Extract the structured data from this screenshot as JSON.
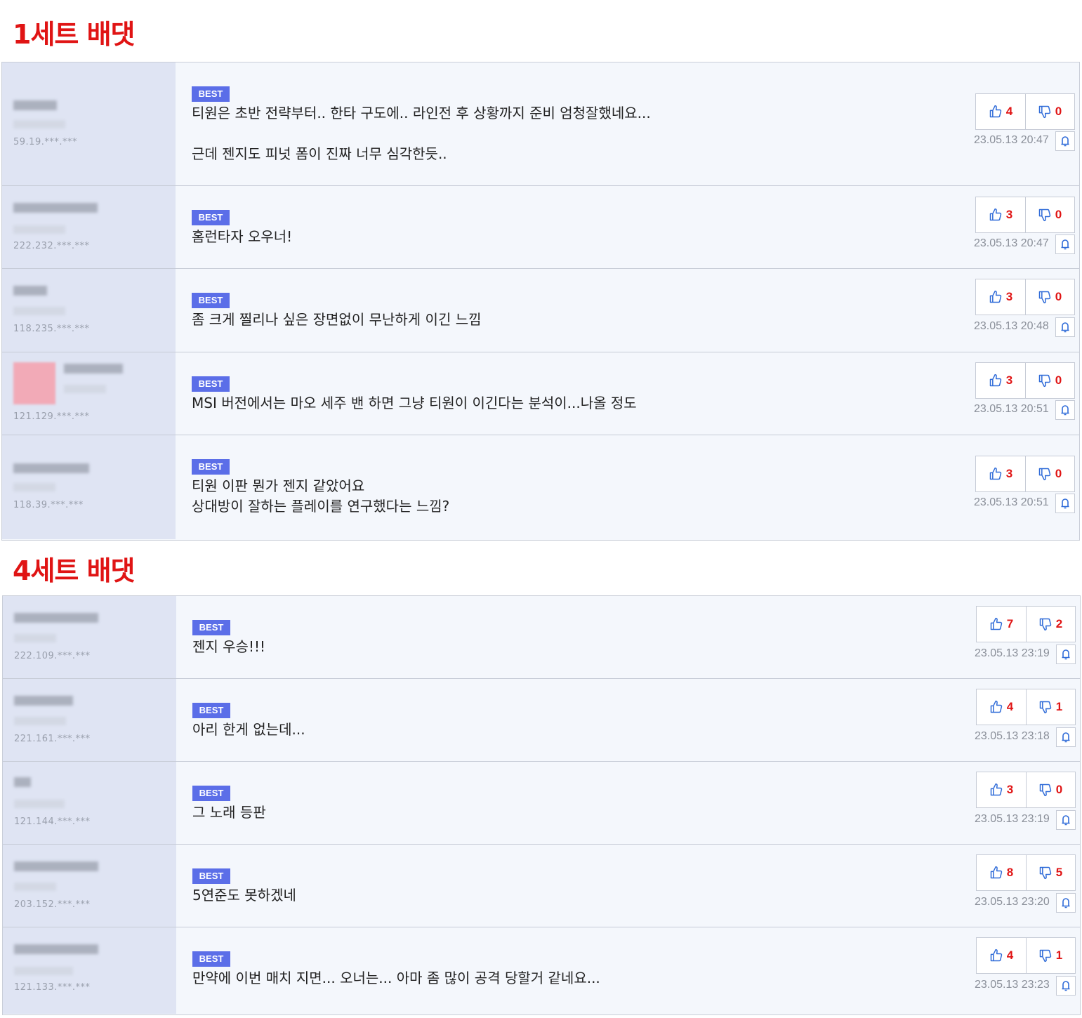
{
  "sections": [
    {
      "title": "1세트 배댓",
      "comments": [
        {
          "ip": "59.19.***.***",
          "badge": "BEST",
          "text": "티원은 초반 전략부터.. 한타 구도에.. 라인전 후 상황까지 준비 엄청잘했네요...\n\n근데 젠지도 피넛 폼이 진짜 너무 심각한듯..",
          "likes": "4",
          "dislikes": "0",
          "date": "23.05.13 20:47"
        },
        {
          "ip": "222.232.***.***",
          "badge": "BEST",
          "text": "홈런타자 오우너!",
          "likes": "3",
          "dislikes": "0",
          "date": "23.05.13 20:47"
        },
        {
          "ip": "118.235.***.***",
          "badge": "BEST",
          "text": "좀 크게 찔리나 싶은 장면없이 무난하게 이긴 느낌",
          "likes": "3",
          "dislikes": "0",
          "date": "23.05.13 20:48"
        },
        {
          "ip": "121.129.***.***",
          "badge": "BEST",
          "text": "MSI 버전에서는 마오 세주 밴 하면 그냥 티원이 이긴다는 분석이...나올 정도",
          "likes": "3",
          "dislikes": "0",
          "date": "23.05.13 20:51"
        },
        {
          "ip": "118.39.***.***",
          "badge": "BEST",
          "text": "티원 이판 뭔가 젠지 같았어요\n상대방이 잘하는 플레이를 연구했다는 느낌?",
          "likes": "3",
          "dislikes": "0",
          "date": "23.05.13 20:51"
        }
      ]
    },
    {
      "title": "4세트 배댓",
      "comments": [
        {
          "ip": "222.109.***.***",
          "badge": "BEST",
          "text": "젠지 우승!!!",
          "likes": "7",
          "dislikes": "2",
          "date": "23.05.13 23:19"
        },
        {
          "ip": "221.161.***.***",
          "badge": "BEST",
          "text": "아리 한게 없는데...",
          "likes": "4",
          "dislikes": "1",
          "date": "23.05.13 23:18"
        },
        {
          "ip": "121.144.***.***",
          "badge": "BEST",
          "text": "그 노래 등판",
          "likes": "3",
          "dislikes": "0",
          "date": "23.05.13 23:19"
        },
        {
          "ip": "203.152.***.***",
          "badge": "BEST",
          "text": "5연준도 못하겠네",
          "likes": "8",
          "dislikes": "5",
          "date": "23.05.13 23:20"
        },
        {
          "ip": "121.133.***.***",
          "badge": "BEST",
          "text": "만약에 이번 매치 지면... 오너는... 아마 좀 많이 공격 당할거 같네요...",
          "likes": "4",
          "dislikes": "1",
          "date": "23.05.13 23:23"
        }
      ]
    }
  ],
  "colors": {
    "title": "#e01414",
    "badge": "#5b6ee8",
    "vote_count": "#e01414",
    "icon": "#2f6bd8"
  },
  "icons": {
    "like": "thumbs-up-icon",
    "dislike": "thumbs-down-icon",
    "report": "bell-icon"
  }
}
